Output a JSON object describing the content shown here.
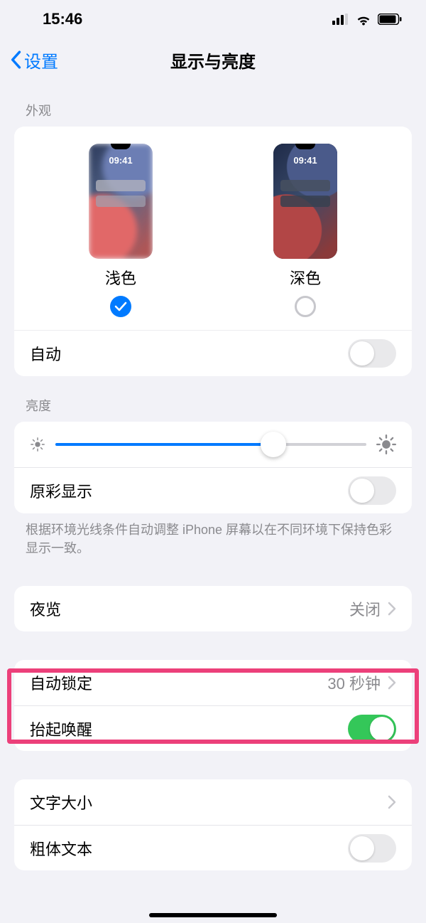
{
  "status": {
    "time": "15:46"
  },
  "nav": {
    "back": "设置",
    "title": "显示与亮度"
  },
  "appearance": {
    "header": "外观",
    "preview_time": "09:41",
    "light": "浅色",
    "dark": "深色",
    "auto": "自动"
  },
  "brightness": {
    "header": "亮度",
    "truetone": "原彩显示",
    "footer": "根据环境光线条件自动调整 iPhone 屏幕以在不同环境下保持色彩显示一致。"
  },
  "nightshift": {
    "label": "夜览",
    "value": "关闭"
  },
  "autolock": {
    "label": "自动锁定",
    "value": "30 秒钟"
  },
  "raise": {
    "label": "抬起唤醒"
  },
  "textsize": {
    "label": "文字大小"
  },
  "bold": {
    "label": "粗体文本"
  }
}
